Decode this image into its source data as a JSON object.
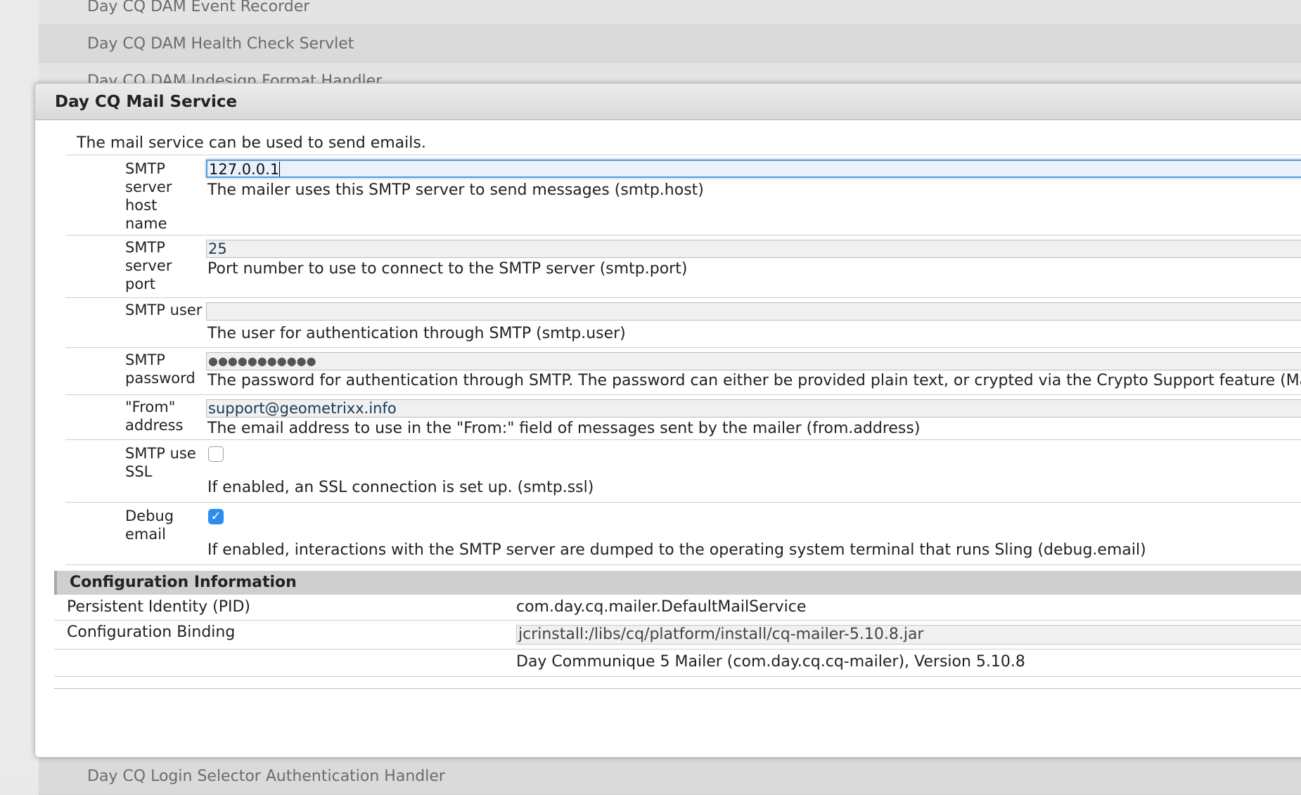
{
  "background_list": {
    "items": [
      "Day CQ DAM Event Recorder",
      "Day CQ DAM Health Check Servlet",
      "Day CQ DAM Indesign Format Handler",
      "Day CQ Login Selector Authentication Handler"
    ]
  },
  "dialog": {
    "title": "Day CQ Mail Service",
    "description": "The mail service can be used to send emails.",
    "fields": [
      {
        "label": "SMTP server host name",
        "value": "127.0.0.1",
        "help": "The mailer uses this SMTP server to send messages (smtp.host)"
      },
      {
        "label": "SMTP server port",
        "value": "25",
        "help": "Port number to use to connect to the SMTP server (smtp.port)"
      },
      {
        "label": "SMTP user",
        "value": "",
        "help": "The user for authentication through SMTP (smtp.user)"
      },
      {
        "label": "SMTP password",
        "value": "●●●●●●●●●●●",
        "help": "The password for authentication through SMTP. The password can either be provided plain text, or crypted via the Crypto Support feature (Main -> Crypto Support)"
      },
      {
        "label": "\"From\" address",
        "value": "support@geometrixx.info",
        "help": "The email address to use in the \"From:\" field of messages sent by the mailer (from.address)"
      },
      {
        "label": "SMTP use SSL",
        "checked": false,
        "help": "If enabled, an SSL connection is set up. (smtp.ssl)"
      },
      {
        "label": "Debug email",
        "checked": true,
        "help": "If enabled, interactions with the SMTP server are dumped to the operating system terminal that runs Sling (debug.email)"
      }
    ],
    "config_info": {
      "heading": "Configuration Information",
      "pid_label": "Persistent Identity (PID)",
      "pid_value": "com.day.cq.mailer.DefaultMailService",
      "binding_label": "Configuration Binding",
      "binding_value": "jcrinstall:/libs/cq/platform/install/cq-mailer-5.10.8.jar",
      "bundle_value": "Day Communique 5 Mailer (com.day.cq.cq-mailer), Version 5.10.8"
    }
  }
}
